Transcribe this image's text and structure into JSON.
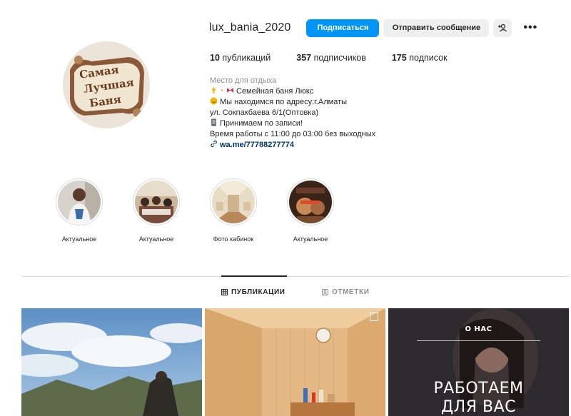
{
  "profile": {
    "username": "lux_bania_2020",
    "follow_label": "Подписаться",
    "message_label": "Отправить сообщение",
    "avatar_text": [
      "Самая",
      "Лучшая",
      "Баня"
    ]
  },
  "stats": {
    "posts_count": "10",
    "posts_label": "публикаций",
    "followers_count": "357",
    "followers_label": "подписчиков",
    "following_count": "175",
    "following_label": "подписок"
  },
  "bio": {
    "category": "Место для отдыха",
    "line1": "Семейная баня Люкс",
    "line2": "Мы находимся по адресу:г.Алматы",
    "line3": "ул. Сокпакбаева 6/1(Оптовка)",
    "line4": "Принимаем по записи!",
    "line5": "Время работы с 11:00 до 03:00 без выходных",
    "link": "wa.me/77788277774"
  },
  "highlights": [
    {
      "label": "Актуальное"
    },
    {
      "label": "Актуальное"
    },
    {
      "label": "Фото кабинок"
    },
    {
      "label": "Актуальное"
    }
  ],
  "tabs": {
    "publications": "ПУБЛИКАЦИИ",
    "tagged": "ОТМЕТКИ"
  },
  "posts": {
    "post3_heading": "О НАС",
    "post3_line1": "РАБОТАЕМ",
    "post3_line2": "ДЛЯ ВАС"
  },
  "colors": {
    "accent": "#0095f6",
    "link": "#00376b",
    "muted": "#8e8e8e"
  }
}
